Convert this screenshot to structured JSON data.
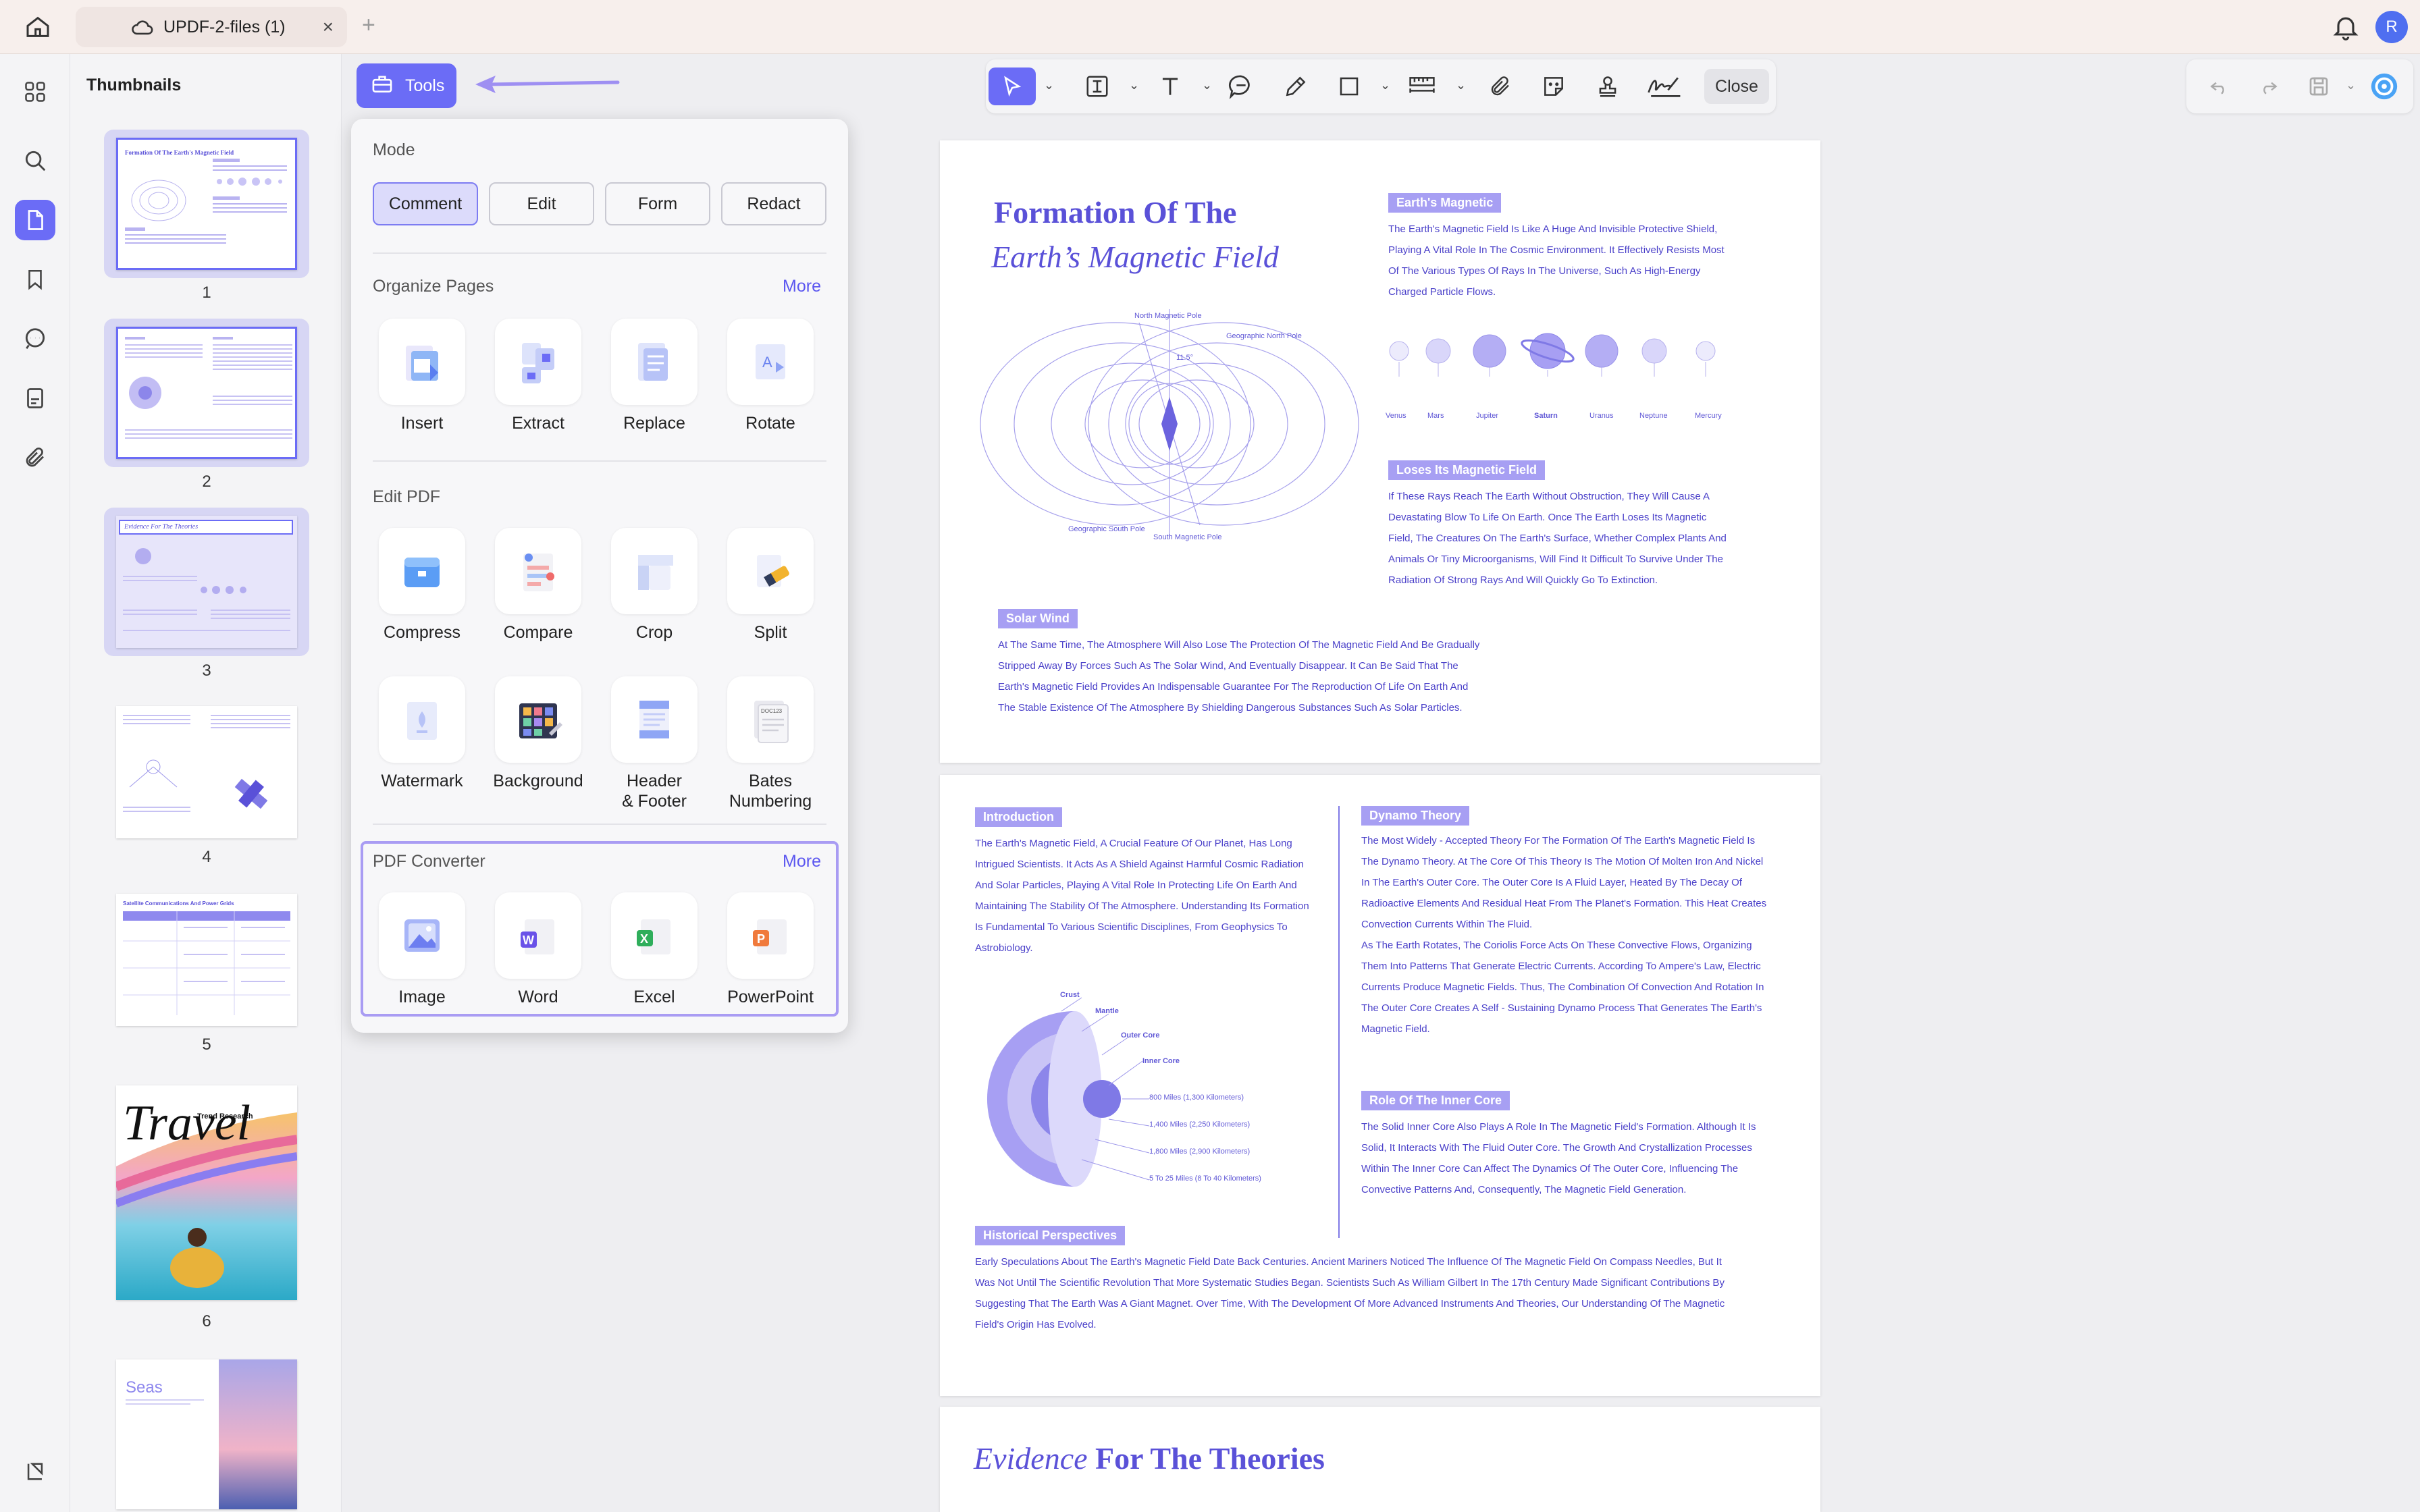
{
  "titlebar": {
    "tab_title": "UPDF-2-files (1)",
    "tab_close": "×",
    "add_tab": "+",
    "avatar_initial": "R"
  },
  "thumbnails": {
    "title": "Thumbnails",
    "pages": [
      {
        "num": "1",
        "title": "Formation Of The Earth's Magnetic Field"
      },
      {
        "num": "2",
        "title": ""
      },
      {
        "num": "3",
        "title": "Evidence For The Theories"
      },
      {
        "num": "4",
        "title": ""
      },
      {
        "num": "5",
        "title": "Satellite Communications And Power Grids"
      },
      {
        "num": "6",
        "title": "Travel",
        "subtitle": "Trend Research"
      },
      {
        "num": "7",
        "title": "Seas"
      }
    ]
  },
  "tools_button": {
    "label": "Tools"
  },
  "tools_panel": {
    "mode": {
      "title": "Mode",
      "options": [
        "Comment",
        "Edit",
        "Form",
        "Redact"
      ],
      "active": "Comment"
    },
    "organize": {
      "title": "Organize Pages",
      "more": "More",
      "items": [
        "Insert",
        "Extract",
        "Replace",
        "Rotate"
      ]
    },
    "edit": {
      "title": "Edit PDF",
      "items": [
        "Compress",
        "Compare",
        "Crop",
        "Split",
        "Watermark",
        "Background",
        "Header\n& Footer",
        "Bates\nNumbering"
      ]
    },
    "converter": {
      "title": "PDF Converter",
      "more": "More",
      "items": [
        "Image",
        "Word",
        "Excel",
        "PowerPoint"
      ]
    }
  },
  "toolbar": {
    "close_label": "Close",
    "icons": [
      "select-icon",
      "textbox-icon",
      "text-icon",
      "comment-icon",
      "pencil-icon",
      "shape-icon",
      "measure-icon",
      "attachment-icon",
      "sticker-icon",
      "stamp-icon",
      "signature-icon"
    ]
  },
  "page1": {
    "title_line1": "Formation Of The",
    "title_line2": "Earth’s Magnetic Field",
    "tag_magnetic": "Earth's Magnetic",
    "text_magnetic": [
      "The Earth's Magnetic Field Is Like A Huge And Invisible Protective Shield,",
      "Playing A Vital Role In The Cosmic Environment. It Effectively Resists Most",
      "Of The Various Types Of Rays In The Universe, Such As High-Energy",
      "Charged Particle Flows."
    ],
    "planets": [
      "Venus",
      "Mars",
      "Jupiter",
      "Saturn",
      "Uranus",
      "Neptune",
      "Mercury"
    ],
    "tag_loses": "Loses Its Magnetic Field",
    "text_loses": [
      "If These Rays Reach The Earth Without Obstruction, They Will Cause A",
      "Devastating Blow To Life On Earth. Once The Earth Loses Its Magnetic",
      "Field, The Creatures On The Earth's Surface, Whether Complex Plants And",
      "Animals Or Tiny Microorganisms, Will Find It Difficult To Survive Under The",
      "Radiation Of Strong Rays And Will Quickly Go To Extinction."
    ],
    "tag_solar": "Solar Wind",
    "text_solar": [
      "At The Same Time, The Atmosphere Will Also Lose The Protection Of The Magnetic Field And Be Gradually",
      "Stripped Away By Forces Such As The Solar Wind, And Eventually Disappear. It Can Be Said That The",
      "Earth's Magnetic Field Provides An Indispensable Guarantee For The Reproduction Of Life On Earth And",
      "The Stable Existence Of The Atmosphere By Shielding Dangerous Substances Such As Solar Particles."
    ],
    "diagram_labels": {
      "north_mag": "North Magnetic Pole",
      "geo_north": "Geographic North Pole",
      "geo_south": "Geographic South Pole",
      "south_mag": "South Magnetic Pole",
      "angle": "11.5°"
    }
  },
  "page2": {
    "tag_intro": "Introduction",
    "text_intro": [
      "The Earth's Magnetic Field, A Crucial Feature Of Our Planet, Has Long",
      "Intrigued Scientists. It Acts As A Shield Against Harmful Cosmic Radiation",
      "And Solar Particles, Playing A Vital Role In Protecting Life On Earth And",
      "Maintaining The Stability Of The Atmosphere. Understanding Its Formation",
      "Is Fundamental To Various Scientific Disciplines, From Geophysics To",
      "Astrobiology."
    ],
    "core_labels": [
      "Crust",
      "Mantle",
      "Outer Core",
      "Inner Core"
    ],
    "core_depths": [
      "800 Miles (1,300 Kilometers)",
      "1,400 Miles (2,250 Kilometers)",
      "1,800 Miles (2,900 Kilometers)",
      "5 To 25 Miles (8 To 40 Kilometers)"
    ],
    "tag_dynamo": "Dynamo Theory",
    "text_dynamo": [
      "The Most Widely - Accepted Theory For The Formation Of The Earth's Magnetic Field Is",
      "The Dynamo Theory. At The Core Of This Theory Is The Motion Of Molten Iron And Nickel",
      "In The Earth's Outer Core. The Outer Core Is A Fluid Layer, Heated By The Decay Of",
      "Radioactive Elements And Residual Heat From The Planet's Formation. This Heat Creates",
      "Convection Currents Within The Fluid.",
      "As The Earth Rotates, The Coriolis Force Acts On These Convective Flows, Organizing",
      "Them Into Patterns That Generate Electric Currents. According To Ampere's Law, Electric",
      "Currents Produce Magnetic Fields. Thus, The Combination Of Convection And Rotation In",
      "The Outer Core Creates A Self - Sustaining Dynamo Process That Generates The Earth's",
      "Magnetic Field."
    ],
    "tag_inner": "Role Of The Inner Core",
    "text_inner": [
      "The Solid Inner Core Also Plays A Role In The Magnetic Field's Formation. Although It Is",
      "Solid, It Interacts With The Fluid Outer Core. The Growth And Crystallization Processes",
      "Within The Inner Core Can Affect The Dynamics Of The Outer Core, Influencing The",
      "Convective Patterns And, Consequently, The Magnetic Field Generation."
    ],
    "tag_hist": "Historical Perspectives",
    "text_hist": [
      "Early Speculations About The Earth's Magnetic Field Date Back Centuries. Ancient Mariners Noticed The Influence Of The Magnetic Field On Compass Needles, But It",
      "Was Not Until The Scientific Revolution That More Systematic Studies Began. Scientists Such As William Gilbert In The 17th Century Made Significant Contributions By",
      "Suggesting That The Earth Was A Giant Magnet. Over Time, With The Development Of More Advanced Instruments And Theories, Our Understanding Of The Magnetic",
      "Field's Origin Has Evolved."
    ]
  },
  "page3": {
    "title_italic": "Evidence",
    "title_rest": " For The Theories"
  },
  "colors": {
    "accent": "#6b6cf6",
    "doc_text": "#4a40c9",
    "tag_bg": "#a79ff3",
    "converter_border": "#a99cf3"
  }
}
